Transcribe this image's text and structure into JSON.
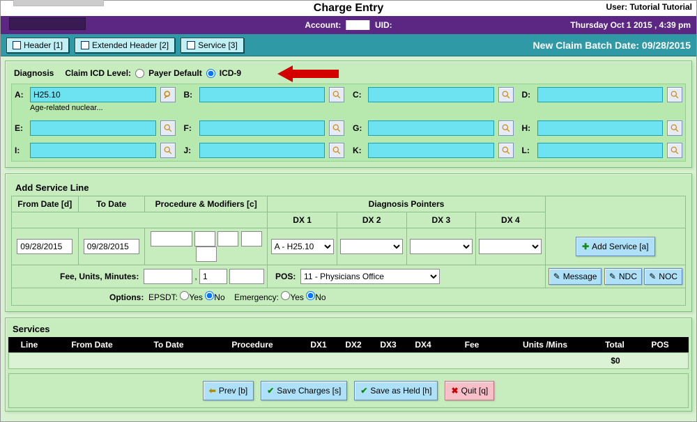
{
  "title": "Charge Entry",
  "user_label": "User: Tutorial Tutorial",
  "account_label": "Account:",
  "uid_label": "UID:",
  "datetime": "Thursday Oct 1 2015 , 4:39 pm",
  "tabs": {
    "header": "Header [1]",
    "ext": "Extended Header [2]",
    "service": "Service [3]"
  },
  "status_text": "New Claim  Batch Date: 09/28/2015",
  "diagnosis": {
    "title": "Diagnosis",
    "icd_label": "Claim ICD Level:",
    "payer_default": "Payer Default",
    "icd9": "ICD-9",
    "fields": {
      "A": {
        "value": "H25.10",
        "desc": "Age-related nuclear..."
      },
      "B": {
        "value": "",
        "desc": ""
      },
      "C": {
        "value": "",
        "desc": ""
      },
      "D": {
        "value": "",
        "desc": ""
      },
      "E": {
        "value": "",
        "desc": ""
      },
      "F": {
        "value": "",
        "desc": ""
      },
      "G": {
        "value": "",
        "desc": ""
      },
      "H": {
        "value": "",
        "desc": ""
      },
      "I": {
        "value": "",
        "desc": ""
      },
      "J": {
        "value": "",
        "desc": ""
      },
      "K": {
        "value": "",
        "desc": ""
      },
      "L": {
        "value": "",
        "desc": ""
      }
    }
  },
  "service": {
    "title": "Add Service Line",
    "from_date_hdr": "From Date [d]",
    "to_date_hdr": "To Date",
    "proc_hdr": "Procedure & Modifiers [c]",
    "diag_ptr_hdr": "Diagnosis Pointers",
    "dx1": "DX 1",
    "dx2": "DX 2",
    "dx3": "DX 3",
    "dx4": "DX 4",
    "from_date": "09/28/2015",
    "to_date": "09/28/2015",
    "dx1_val": "A - H25.10",
    "add_btn": "Add Service [a]",
    "fee_label": "Fee, Units, Minutes:",
    "units_val": "1",
    "pos_label": "POS:",
    "pos_val": "11 - Physicians Office",
    "message": "Message",
    "ndc": "NDC",
    "noc": "NOC",
    "options_label": "Options:",
    "epsdt_label": "EPSDT:",
    "emergency_label": "Emergency:",
    "yes": "Yes",
    "no": "No"
  },
  "services_panel": {
    "title": "Services",
    "cols": {
      "line": "Line",
      "from": "From Date",
      "to": "To Date",
      "proc": "Procedure",
      "dx1": "DX1",
      "dx2": "DX2",
      "dx3": "DX3",
      "dx4": "DX4",
      "fee": "Fee",
      "units": "Units /Mins",
      "total": "Total",
      "pos": "POS"
    },
    "total": "$0"
  },
  "actions": {
    "prev": "Prev [b]",
    "save": "Save Charges [s]",
    "held": "Save as Held [h]",
    "quit": "Quit [q]"
  }
}
